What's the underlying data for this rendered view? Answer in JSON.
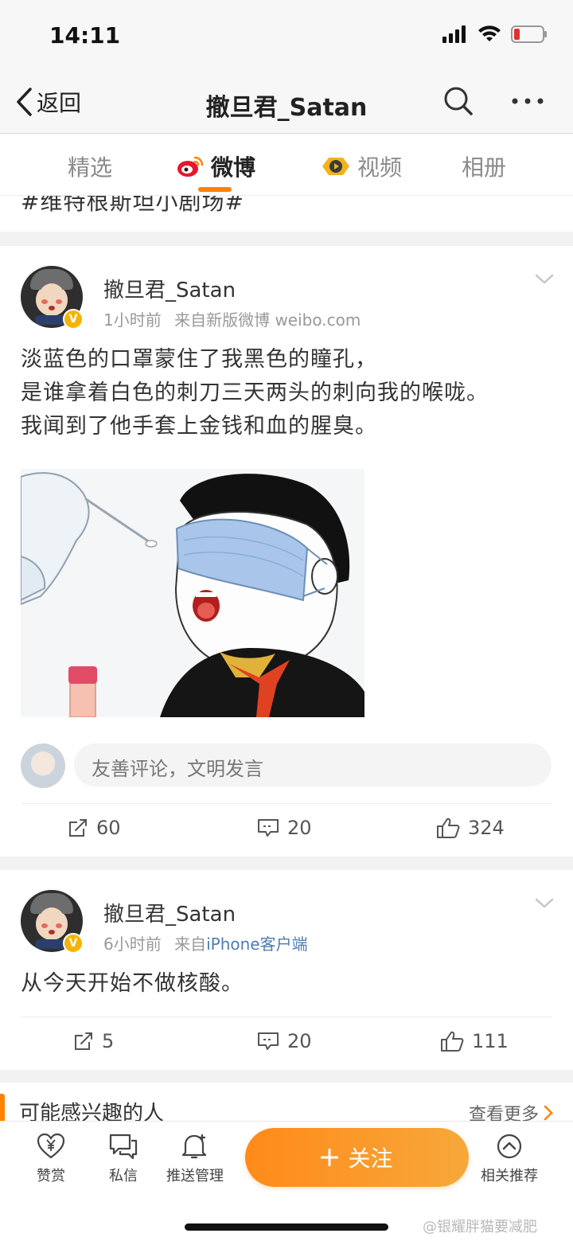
{
  "status_bar": {
    "time": "14:11"
  },
  "nav": {
    "back_label": "返回",
    "title": "撤旦君_Satan"
  },
  "tabs": [
    {
      "label": "精选"
    },
    {
      "label": "微博"
    },
    {
      "label": "视频"
    },
    {
      "label": "相册"
    }
  ],
  "topic_strip": {
    "text": "#维特根斯坦小剧场#"
  },
  "posts": [
    {
      "user_name": "撤旦君_Satan",
      "time": "1小时前",
      "source_prefix": "来自",
      "source": "新版微博 weibo.com",
      "lines": [
        "淡蓝色的口罩蒙住了我黑色的瞳孔，",
        "是谁拿着白色的刺刀三天两头的刺向我的喉咙。",
        "我闻到了他手套上金钱和血的腥臭。"
      ],
      "comment_placeholder": "友善评论，文明发言",
      "reposts": "60",
      "comments": "20",
      "likes": "324"
    },
    {
      "user_name": "撤旦君_Satan",
      "time": "6小时前",
      "source_prefix": "来自",
      "source": "iPhone客户端",
      "lines": [
        "从今天开始不做核酸。"
      ],
      "reposts": "5",
      "comments": "20",
      "likes": "111"
    }
  ],
  "suggest": {
    "title": "可能感兴趣的人",
    "see_more": "查看更多"
  },
  "toolbar": {
    "reward": "赞赏",
    "message": "私信",
    "push": "推送管理",
    "follow": "关注",
    "related": "相关推荐"
  },
  "watermark": "@银耀胖猫要减肥",
  "colors": {
    "accent": "#ff8200",
    "link": "#4f7cae",
    "verify": "#f6b400"
  }
}
